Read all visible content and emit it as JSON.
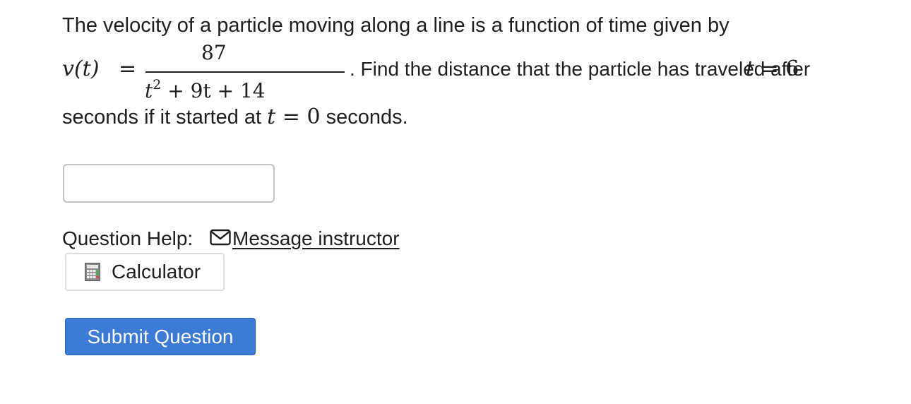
{
  "question": {
    "line1": "The velocity of a particle moving along a line is a function of time given by",
    "v_lhs": "v(t)",
    "equals": "=",
    "numerator": "87",
    "denominator_base": "t",
    "denominator_exp": "2",
    "denominator_rest": " + 9t + 14",
    "after_fraction": ". Find the distance that the particle has traveled after ",
    "t_var": "t",
    "t_end_value": "6",
    "line3_prefix": "seconds if it started at ",
    "t_start_value": "0",
    "line3_suffix": " seconds."
  },
  "answer": {
    "value": "",
    "placeholder": ""
  },
  "help": {
    "label": "Question Help:",
    "message_link": "Message instructor",
    "calculator_label": "Calculator"
  },
  "submit": {
    "label": "Submit Question"
  },
  "colors": {
    "submit_bg": "#3b7bd6",
    "text": "#1f1f1f",
    "input_border": "#c3c3c3"
  },
  "icons": {
    "message": "mail-icon",
    "calculator": "calculator-icon"
  }
}
